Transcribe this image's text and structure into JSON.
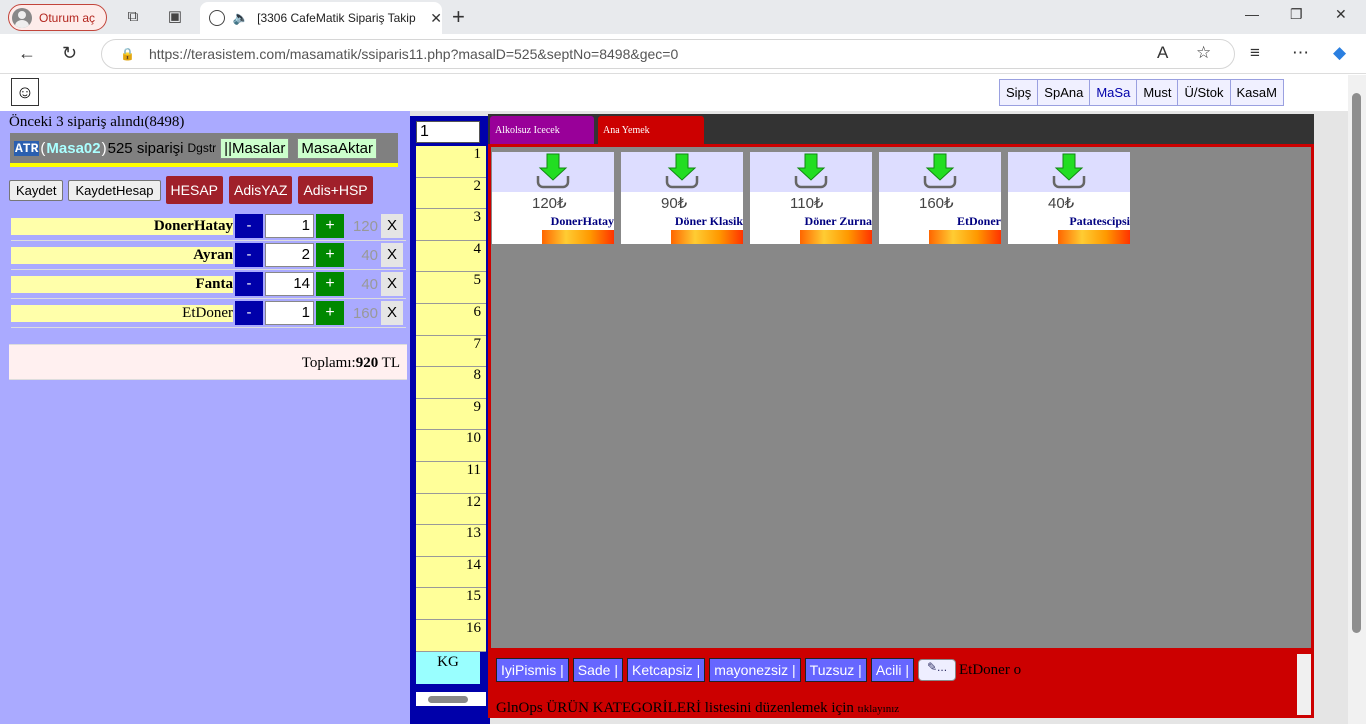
{
  "browser": {
    "profile_label": "Oturum aç",
    "tab_title": "[3306 CafeMatik Sipariş Takip",
    "url": "https://terasistem.com/masamatik/ssiparis11.php?masalD=525&septNo=8498&gec=0"
  },
  "topnav": [
    "Sipş",
    "SpAna",
    "MaSa",
    "Must",
    "Ü/Stok",
    "KasaM"
  ],
  "left": {
    "previous_text": "Önceki 3 sipariş alındı(8498)",
    "header": {
      "logo": "ATR",
      "masa": "Masa02",
      "order_count": "525 siparişi",
      "dgstr": "Dgstr",
      "masalar_btn": "||Masalar",
      "masaaktar_btn": "MasaAktar"
    },
    "actions": {
      "kaydet": "Kaydet",
      "kaydet_hesap": "KaydetHesap",
      "hesap": "HESAP",
      "adis_yaz": "AdisYAZ",
      "adis_hsp": "Adis+HSP"
    },
    "items": [
      {
        "name": "DonerHatay",
        "qty": "1",
        "price": "120",
        "bold": true
      },
      {
        "name": "Ayran",
        "qty": "2",
        "price": "40",
        "bold": true
      },
      {
        "name": "Fanta",
        "qty": "14",
        "price": "40",
        "bold": true
      },
      {
        "name": "EtDoner",
        "qty": "1",
        "price": "160",
        "bold": false
      }
    ],
    "minus": "-",
    "plus": "+",
    "remove": "X",
    "total_label": "Toplamı:",
    "total_value": "920",
    "total_currency": " TL"
  },
  "numbers": {
    "table_input": "1",
    "list": [
      "1",
      "2",
      "3",
      "4",
      "5",
      "6",
      "7",
      "8",
      "9",
      "10",
      "11",
      "12",
      "13",
      "14",
      "15",
      "16"
    ],
    "kg": "KG"
  },
  "categories": [
    {
      "label": "Alkolsuz Icecek",
      "color": "#990099"
    },
    {
      "label": "Ana Yemek",
      "color": "#cc0000"
    }
  ],
  "products": [
    {
      "name": "DonerHatay",
      "price": "120₺"
    },
    {
      "name": "Döner Klasik",
      "price": "90₺"
    },
    {
      "name": "Döner Zurna",
      "price": "110₺"
    },
    {
      "name": "EtDoner",
      "price": "160₺"
    },
    {
      "name": "Patatescipsi",
      "price": "40₺"
    }
  ],
  "notes": {
    "tags": [
      "IyiPismis |",
      "Sade |",
      "Ketcapsiz |",
      "mayonezsiz |",
      "Tuzsuz |",
      "Acili |"
    ],
    "edit_label": "...",
    "item_note": "EtDoner o",
    "footer_text": "GlnOps ÜRÜN KATEGORİLERİ listesini düzenlemek için",
    "footer_link": "tıklayınız"
  }
}
